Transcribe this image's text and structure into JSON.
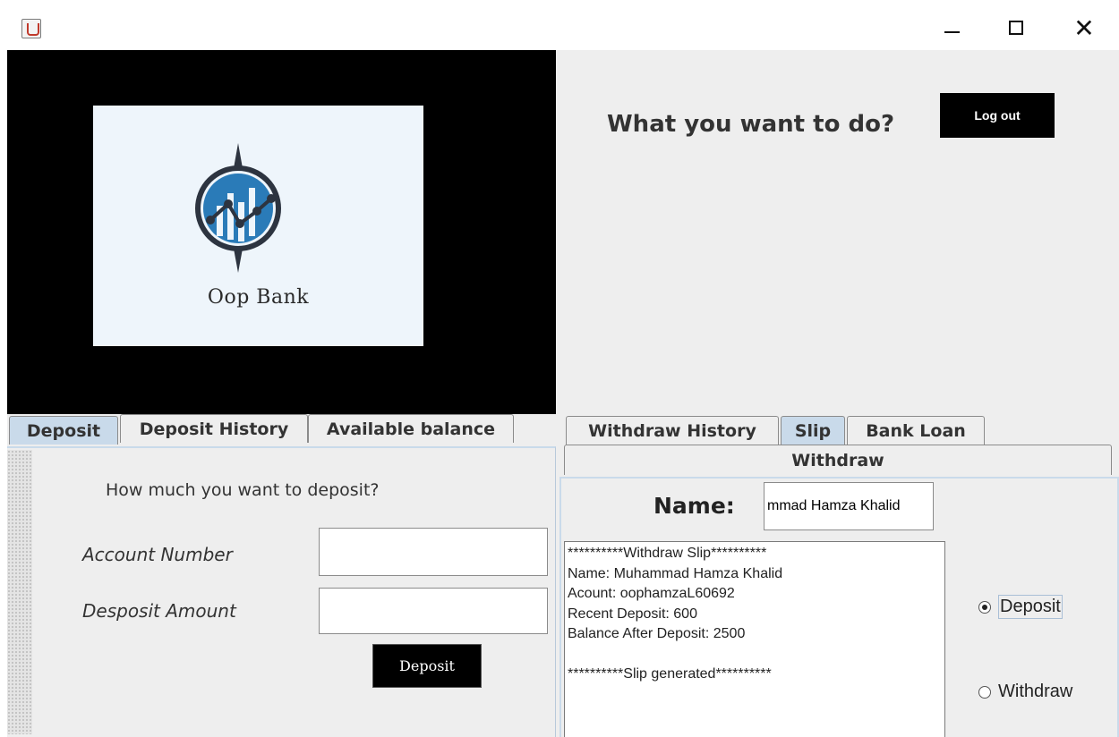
{
  "window": {
    "close_glyph": "✕"
  },
  "logo": {
    "bank_name": "Oop Bank"
  },
  "header": {
    "question": "What you want to do?",
    "logout_label": "Log out"
  },
  "left_tabs": {
    "items": [
      {
        "label": "Deposit",
        "selected": true
      },
      {
        "label": "Deposit History",
        "selected": false
      },
      {
        "label": "Available balance",
        "selected": false
      }
    ]
  },
  "deposit_form": {
    "prompt": "How much you want to deposit?",
    "account_label": "Account Number",
    "account_value": "",
    "amount_label": "Desposit Amount",
    "amount_value": "",
    "submit_label": "Deposit"
  },
  "right_tabs": {
    "items": [
      {
        "label": "Withdraw History",
        "selected": false
      },
      {
        "label": "Slip",
        "selected": true
      },
      {
        "label": "Bank Loan",
        "selected": false
      },
      {
        "label": "Withdraw",
        "selected": false
      }
    ]
  },
  "slip": {
    "name_label": "Name:",
    "name_value": "mmad Hamza Khalid",
    "text": "**********Withdraw Slip**********\nName: Muhammad Hamza Khalid\nAcount: oophamzaL60692\nRecent Deposit: 600\nBalance After Deposit: 2500\n\n**********Slip generated**********",
    "options": [
      {
        "label": "Deposit",
        "checked": true
      },
      {
        "label": "Withdraw",
        "checked": false
      }
    ]
  },
  "colors": {
    "selected_tab": "#c9daea",
    "panel_bg": "#eeeeee",
    "logo_bg": "#000000",
    "logo_blue": "#2a7bb8"
  },
  "icons": [
    "java-app-icon",
    "minimize-icon",
    "maximize-icon",
    "close-icon",
    "compass-chart-logo-icon"
  ]
}
